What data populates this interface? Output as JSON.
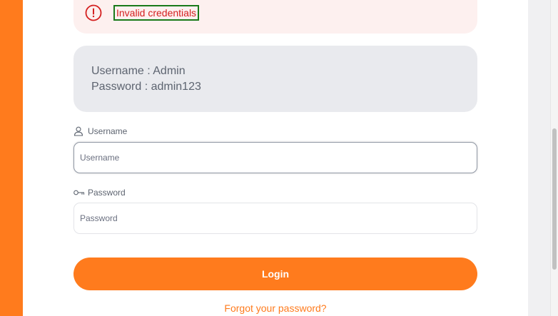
{
  "alert": {
    "message": "Invalid credentials",
    "icon": "exclamation-circle-icon",
    "color": "#d42020"
  },
  "credentials": {
    "username_line": "Username : Admin",
    "password_line": "Password : admin123"
  },
  "form": {
    "username_label": "Username",
    "username_placeholder": "Username",
    "username_value": "",
    "password_label": "Password",
    "password_placeholder": "Password",
    "password_value": "",
    "login_label": "Login",
    "forgot_label": "Forgot your password?"
  },
  "colors": {
    "brand": "#ff7b1d",
    "error": "#d42020"
  }
}
